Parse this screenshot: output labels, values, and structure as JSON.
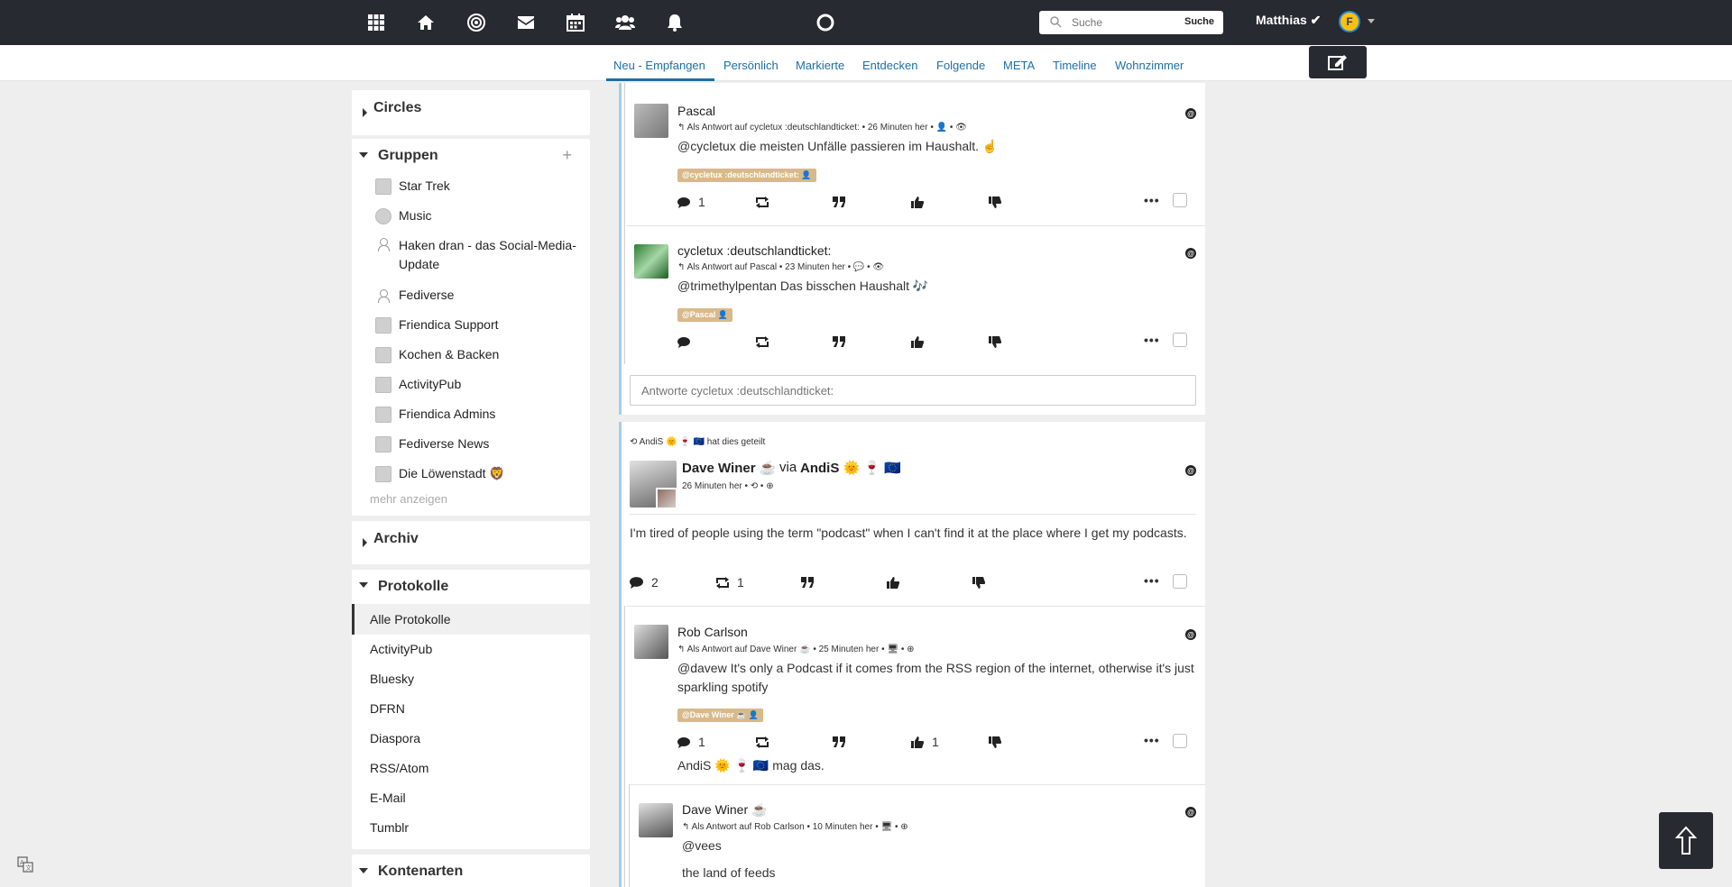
{
  "topbar": {
    "icons": [
      "apps-icon",
      "home-icon",
      "network-icon",
      "mail-icon",
      "calendar-icon",
      "contacts-icon",
      "bell-icon",
      "loading-spinner-icon"
    ],
    "search_placeholder": "Suche",
    "search_button": "Suche",
    "user_name": "Matthias ✔",
    "avatar_letter": "F"
  },
  "tabs": [
    "Neu - Empfangen",
    "Persönlich",
    "Markierte",
    "Entdecken",
    "Folgende",
    "META",
    "Timeline",
    "Wohnzimmer"
  ],
  "sidebar": {
    "circles_title": "Circles",
    "groups_title": "Gruppen",
    "groups": [
      "Star Trek",
      "Music",
      "Haken dran - das Social-Media-Update",
      "Fediverse",
      "Friendica Support",
      "Kochen & Backen",
      "ActivityPub",
      "Friendica Admins",
      "Fediverse News",
      "Die Löwenstadt 🦁"
    ],
    "more_label": "mehr anzeigen",
    "archive_title": "Archiv",
    "protocols_title": "Protokolle",
    "protocols": [
      "Alle Protokolle",
      "ActivityPub",
      "Bluesky",
      "DFRN",
      "Diaspora",
      "RSS/Atom",
      "E-Mail",
      "Tumblr"
    ],
    "account_types_title": "Kontenarten"
  },
  "posts": {
    "p1": {
      "author": "Pascal",
      "meta": "↰ Als Antwort auf cycletux :deutschlandticket: • 26 Minuten her • 👤 • 👁",
      "text": "@cycletux die meisten Unfälle passieren im Haushalt. ☝️",
      "tag": "@cycletux :deutschlandticket: 👤",
      "comments": "1"
    },
    "p2": {
      "author": "cycletux :deutschlandticket:",
      "meta": "↰ Als Antwort auf Pascal • 23 Minuten her • 💬 • 👁",
      "text": "@trimethylpentan Das bisschen Haushalt 🎶",
      "tag": "@Pascal 👤"
    },
    "reply_placeholder": "Antworte cycletux :deutschlandticket:",
    "shared_by": "⟲ AndiS 🌞 🍷 🇪🇺 hat dies geteilt",
    "p3": {
      "author": "Dave Winer ☕",
      "via": "via",
      "via_author": "AndiS 🌞 🍷 🇪🇺",
      "meta": "26 Minuten her • ⟲ • ⊕",
      "text": "I'm tired of people using the term \"podcast\" when I can't find it at the place where I get my podcasts.",
      "comments": "2",
      "reshares": "1"
    },
    "p4": {
      "author": "Rob Carlson",
      "meta": "↰ Als Antwort auf Dave Winer ☕ • 25 Minuten her • 🖥 • ⊕",
      "text": "@davew It's only a Podcast if it comes from the RSS region of the internet, otherwise it's just sparkling spotify",
      "tag": "@Dave Winer ☕ 👤",
      "comments": "1",
      "likes": "1",
      "liked_by": "AndiS 🌞 🍷 🇪🇺 mag das."
    },
    "p5": {
      "author": "Dave Winer ☕",
      "meta": "↰ Als Antwort auf Rob Carlson • 10 Minuten her • 🖥 • ⊕",
      "text1": "@vees",
      "text2": "the land of feeds"
    }
  },
  "colors": {
    "navbar": "#272a30",
    "link": "#1d6fa5",
    "tag": "#d9b98a",
    "thread_line": "#a5d0e6"
  }
}
